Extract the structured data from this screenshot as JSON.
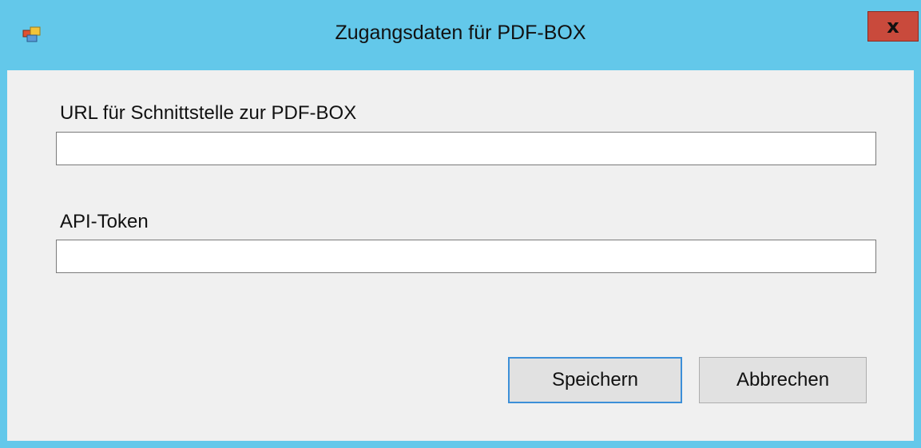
{
  "window": {
    "title": "Zugangsdaten für PDF-BOX",
    "close_label": "x",
    "titlebar_color": "#63c8ea",
    "close_color": "#c94a3c"
  },
  "form": {
    "url_label": "URL für Schnittstelle zur PDF-BOX",
    "url_value": "",
    "token_label": "API-Token",
    "token_value": ""
  },
  "buttons": {
    "save_label": "Speichern",
    "cancel_label": "Abbrechen"
  },
  "icons": {
    "app_icon": "windows-form-icon",
    "close_icon": "close-icon"
  }
}
